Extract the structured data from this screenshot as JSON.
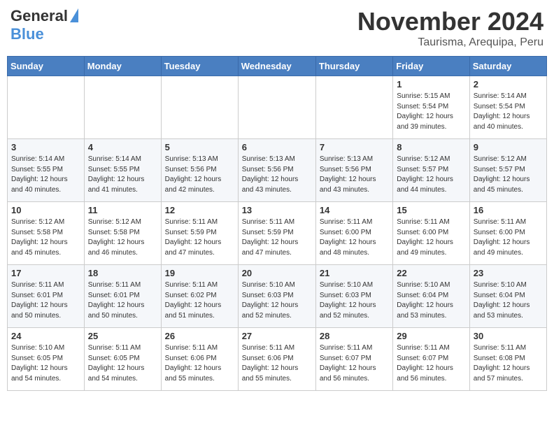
{
  "logo": {
    "general": "General",
    "blue": "Blue"
  },
  "title": {
    "month_year": "November 2024",
    "location": "Taurisma, Arequipa, Peru"
  },
  "days_of_week": [
    "Sunday",
    "Monday",
    "Tuesday",
    "Wednesday",
    "Thursday",
    "Friday",
    "Saturday"
  ],
  "weeks": [
    [
      {
        "day": "",
        "info": ""
      },
      {
        "day": "",
        "info": ""
      },
      {
        "day": "",
        "info": ""
      },
      {
        "day": "",
        "info": ""
      },
      {
        "day": "",
        "info": ""
      },
      {
        "day": "1",
        "info": "Sunrise: 5:15 AM\nSunset: 5:54 PM\nDaylight: 12 hours\nand 39 minutes."
      },
      {
        "day": "2",
        "info": "Sunrise: 5:14 AM\nSunset: 5:54 PM\nDaylight: 12 hours\nand 40 minutes."
      }
    ],
    [
      {
        "day": "3",
        "info": "Sunrise: 5:14 AM\nSunset: 5:55 PM\nDaylight: 12 hours\nand 40 minutes."
      },
      {
        "day": "4",
        "info": "Sunrise: 5:14 AM\nSunset: 5:55 PM\nDaylight: 12 hours\nand 41 minutes."
      },
      {
        "day": "5",
        "info": "Sunrise: 5:13 AM\nSunset: 5:56 PM\nDaylight: 12 hours\nand 42 minutes."
      },
      {
        "day": "6",
        "info": "Sunrise: 5:13 AM\nSunset: 5:56 PM\nDaylight: 12 hours\nand 43 minutes."
      },
      {
        "day": "7",
        "info": "Sunrise: 5:13 AM\nSunset: 5:56 PM\nDaylight: 12 hours\nand 43 minutes."
      },
      {
        "day": "8",
        "info": "Sunrise: 5:12 AM\nSunset: 5:57 PM\nDaylight: 12 hours\nand 44 minutes."
      },
      {
        "day": "9",
        "info": "Sunrise: 5:12 AM\nSunset: 5:57 PM\nDaylight: 12 hours\nand 45 minutes."
      }
    ],
    [
      {
        "day": "10",
        "info": "Sunrise: 5:12 AM\nSunset: 5:58 PM\nDaylight: 12 hours\nand 45 minutes."
      },
      {
        "day": "11",
        "info": "Sunrise: 5:12 AM\nSunset: 5:58 PM\nDaylight: 12 hours\nand 46 minutes."
      },
      {
        "day": "12",
        "info": "Sunrise: 5:11 AM\nSunset: 5:59 PM\nDaylight: 12 hours\nand 47 minutes."
      },
      {
        "day": "13",
        "info": "Sunrise: 5:11 AM\nSunset: 5:59 PM\nDaylight: 12 hours\nand 47 minutes."
      },
      {
        "day": "14",
        "info": "Sunrise: 5:11 AM\nSunset: 6:00 PM\nDaylight: 12 hours\nand 48 minutes."
      },
      {
        "day": "15",
        "info": "Sunrise: 5:11 AM\nSunset: 6:00 PM\nDaylight: 12 hours\nand 49 minutes."
      },
      {
        "day": "16",
        "info": "Sunrise: 5:11 AM\nSunset: 6:00 PM\nDaylight: 12 hours\nand 49 minutes."
      }
    ],
    [
      {
        "day": "17",
        "info": "Sunrise: 5:11 AM\nSunset: 6:01 PM\nDaylight: 12 hours\nand 50 minutes."
      },
      {
        "day": "18",
        "info": "Sunrise: 5:11 AM\nSunset: 6:01 PM\nDaylight: 12 hours\nand 50 minutes."
      },
      {
        "day": "19",
        "info": "Sunrise: 5:11 AM\nSunset: 6:02 PM\nDaylight: 12 hours\nand 51 minutes."
      },
      {
        "day": "20",
        "info": "Sunrise: 5:10 AM\nSunset: 6:03 PM\nDaylight: 12 hours\nand 52 minutes."
      },
      {
        "day": "21",
        "info": "Sunrise: 5:10 AM\nSunset: 6:03 PM\nDaylight: 12 hours\nand 52 minutes."
      },
      {
        "day": "22",
        "info": "Sunrise: 5:10 AM\nSunset: 6:04 PM\nDaylight: 12 hours\nand 53 minutes."
      },
      {
        "day": "23",
        "info": "Sunrise: 5:10 AM\nSunset: 6:04 PM\nDaylight: 12 hours\nand 53 minutes."
      }
    ],
    [
      {
        "day": "24",
        "info": "Sunrise: 5:10 AM\nSunset: 6:05 PM\nDaylight: 12 hours\nand 54 minutes."
      },
      {
        "day": "25",
        "info": "Sunrise: 5:11 AM\nSunset: 6:05 PM\nDaylight: 12 hours\nand 54 minutes."
      },
      {
        "day": "26",
        "info": "Sunrise: 5:11 AM\nSunset: 6:06 PM\nDaylight: 12 hours\nand 55 minutes."
      },
      {
        "day": "27",
        "info": "Sunrise: 5:11 AM\nSunset: 6:06 PM\nDaylight: 12 hours\nand 55 minutes."
      },
      {
        "day": "28",
        "info": "Sunrise: 5:11 AM\nSunset: 6:07 PM\nDaylight: 12 hours\nand 56 minutes."
      },
      {
        "day": "29",
        "info": "Sunrise: 5:11 AM\nSunset: 6:07 PM\nDaylight: 12 hours\nand 56 minutes."
      },
      {
        "day": "30",
        "info": "Sunrise: 5:11 AM\nSunset: 6:08 PM\nDaylight: 12 hours\nand 57 minutes."
      }
    ]
  ]
}
